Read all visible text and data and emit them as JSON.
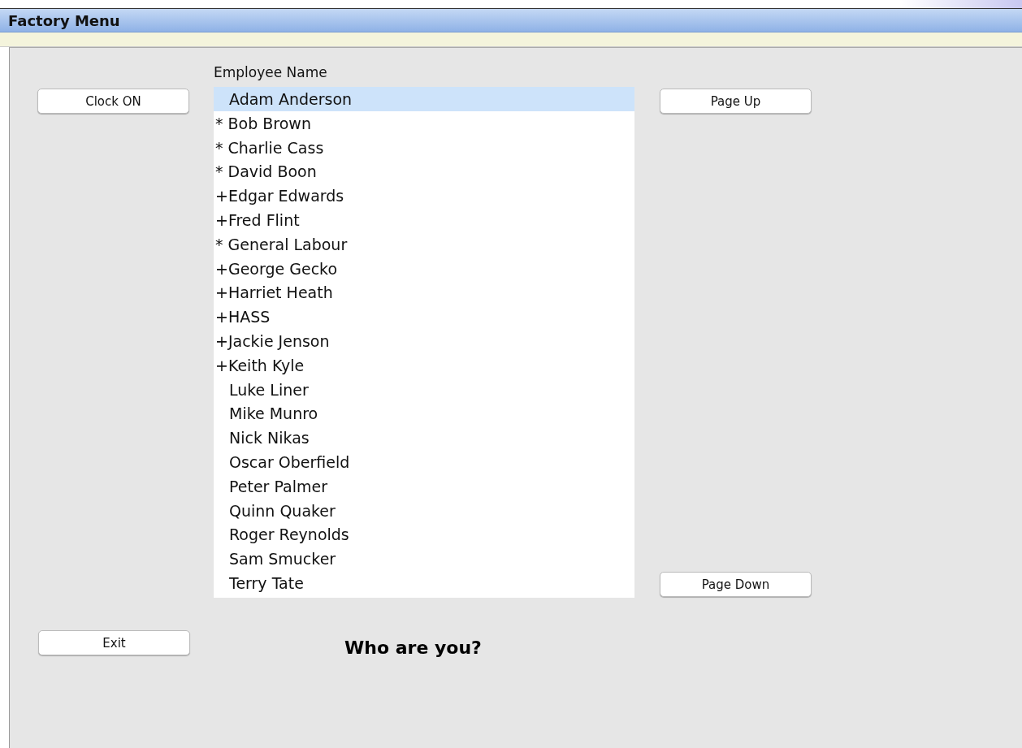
{
  "window": {
    "title": "Factory Menu"
  },
  "buttons_left": [
    {
      "label": "Clock ON"
    }
  ],
  "list": {
    "header": "Employee Name",
    "items": [
      {
        "label": "Adam Anderson",
        "marked": false,
        "selected": true
      },
      {
        "label": "* Bob Brown",
        "marked": true,
        "selected": false
      },
      {
        "label": "* Charlie Cass",
        "marked": true,
        "selected": false
      },
      {
        "label": "* David Boon",
        "marked": true,
        "selected": false
      },
      {
        "label": "+Edgar Edwards",
        "marked": true,
        "selected": false
      },
      {
        "label": "+Fred Flint",
        "marked": true,
        "selected": false
      },
      {
        "label": "* General Labour",
        "marked": true,
        "selected": false
      },
      {
        "label": "+George Gecko",
        "marked": true,
        "selected": false
      },
      {
        "label": "+Harriet Heath",
        "marked": true,
        "selected": false
      },
      {
        "label": "+HASS",
        "marked": true,
        "selected": false
      },
      {
        "label": "+Jackie Jenson",
        "marked": true,
        "selected": false
      },
      {
        "label": "+Keith Kyle",
        "marked": true,
        "selected": false
      },
      {
        "label": "Luke Liner",
        "marked": false,
        "selected": false
      },
      {
        "label": "Mike Munro",
        "marked": false,
        "selected": false
      },
      {
        "label": "Nick Nikas",
        "marked": false,
        "selected": false
      },
      {
        "label": "Oscar Oberfield",
        "marked": false,
        "selected": false
      },
      {
        "label": "Peter Palmer",
        "marked": false,
        "selected": false
      },
      {
        "label": "Quinn Quaker",
        "marked": false,
        "selected": false
      },
      {
        "label": "Roger Reynolds",
        "marked": false,
        "selected": false
      },
      {
        "label": "Sam Smucker",
        "marked": false,
        "selected": false
      },
      {
        "label": "Terry Tate",
        "marked": false,
        "selected": false
      }
    ]
  },
  "page_up": "Page Up",
  "page_down": "Page Down",
  "exit": "Exit",
  "prompt": "Who are you?"
}
